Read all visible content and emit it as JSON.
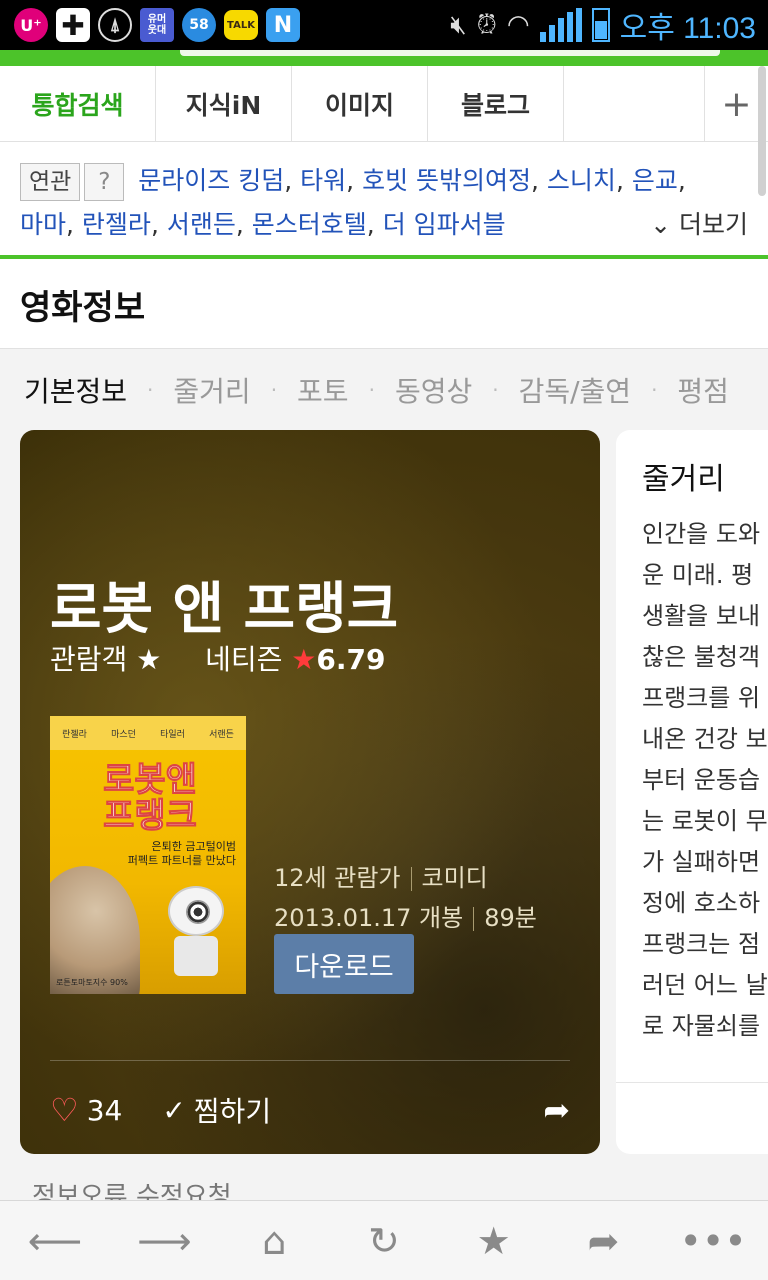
{
  "status_bar": {
    "app_icons": [
      "uplus-icon",
      "plus-icon",
      "compass-icon",
      "humor-icon",
      "badge-58-icon",
      "kakaotalk-icon",
      "naver-n-icon"
    ],
    "humor_label": "유머\n웃대",
    "badge_58": "58",
    "talk_label": "TALK",
    "n_label": "N",
    "time": "오후 11:03"
  },
  "tabs": [
    {
      "label": "통합검색",
      "active": true
    },
    {
      "label": "지식iN",
      "active": false
    },
    {
      "label": "이미지",
      "active": false
    },
    {
      "label": "블로그",
      "active": false
    }
  ],
  "tab_add_label": "+",
  "related": {
    "badge": "연관",
    "help": "?",
    "items": [
      "문라이즈 킹덤",
      "타워",
      "호빗 뜻밖의여정",
      "스니치",
      "은교",
      "마마",
      "란젤라",
      "서랜든",
      "몬스터호텔",
      "더 임파서블"
    ],
    "more_label": "더보기"
  },
  "section_title": "영화정보",
  "subnav": [
    "기본정보",
    "줄거리",
    "포토",
    "동영상",
    "감독/출연",
    "평점"
  ],
  "movie": {
    "title": "로봇 앤 프랭크",
    "audience_label": "관람객",
    "netizen_label": "네티즌",
    "netizen_score": "6.79",
    "rating": "12세 관람가",
    "genre": "코미디",
    "release": "2013.01.17 개봉",
    "runtime": "89분",
    "download_label": "다운로드",
    "likes": "34",
    "wish_label": "찜하기"
  },
  "poster": {
    "cast": [
      "란젤라",
      "마스던",
      "타일러",
      "서랜든"
    ],
    "title_line1": "로봇앤",
    "title_line2": "프랭크",
    "tagline_line1": "은퇴한 금고털이범",
    "tagline_line2": "퍼펙트 파트너를 만났다",
    "bottom_text": "로튼토마토지수 90%"
  },
  "synopsis": {
    "title": "줄거리",
    "lines": [
      "인간을 도와",
      "운 미래. 평",
      "생활을 보내",
      "찮은 불청객",
      "프랭크를 위",
      "내온 건강 보",
      "부터 운동습",
      "는 로봇이 무",
      "가 실패하면",
      "정에 호소하",
      "프랭크는 점",
      "러던 어느 날",
      "로 자물쇠를"
    ]
  },
  "partial_text": "정보오류 수정요청",
  "bottom_nav": [
    "back-icon",
    "forward-icon",
    "home-icon",
    "refresh-icon",
    "bookmark-star-icon",
    "share-icon",
    "more-icon"
  ],
  "colors": {
    "accent_green": "#4cc32a",
    "link_blue": "#2253b9",
    "download_button": "#5c7ea8",
    "status_blue": "#4fb6ff"
  }
}
